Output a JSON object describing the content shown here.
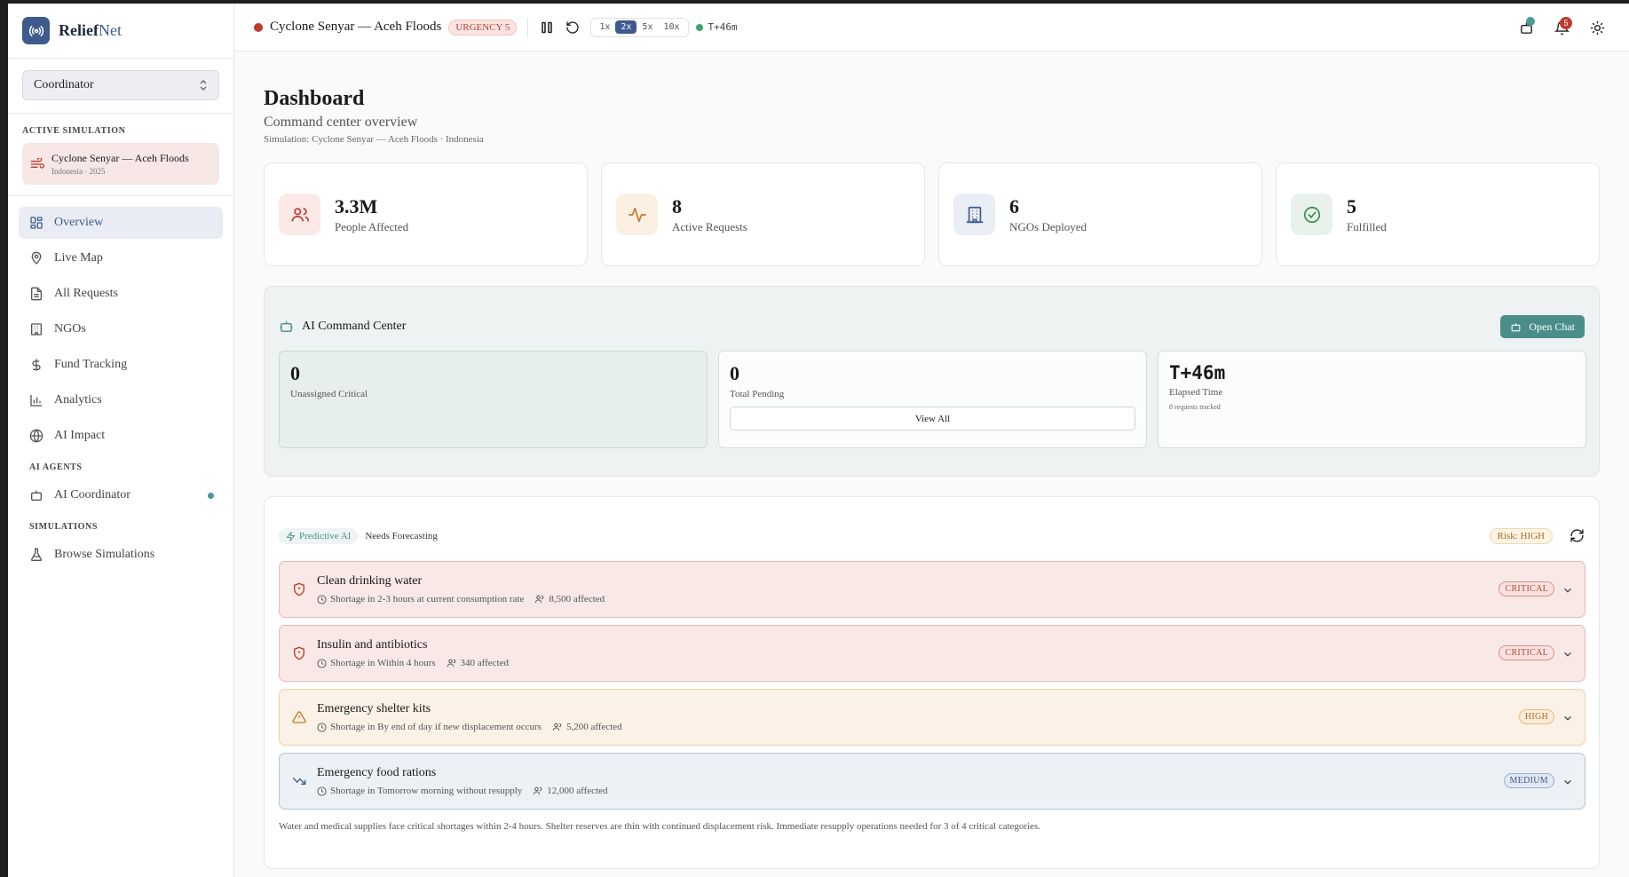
{
  "brand": {
    "name_a": "Relief",
    "name_b": "Net"
  },
  "role": {
    "selected": "Coordinator"
  },
  "active_simulation": {
    "label": "ACTIVE SIMULATION",
    "title": "Cyclone Senyar — Aceh Floods",
    "subtitle": "Indonesia · 2025"
  },
  "nav": {
    "items": [
      {
        "label": "Overview",
        "icon": "grid-icon"
      },
      {
        "label": "Live Map",
        "icon": "map-pin-icon"
      },
      {
        "label": "All Requests",
        "icon": "document-icon"
      },
      {
        "label": "NGOs",
        "icon": "building-icon"
      },
      {
        "label": "Fund Tracking",
        "icon": "dollar-icon"
      },
      {
        "label": "Analytics",
        "icon": "bar-chart-icon"
      },
      {
        "label": "AI Impact",
        "icon": "globe-icon"
      }
    ],
    "agents_label": "AI AGENTS",
    "agent_item": "AI Coordinator",
    "simulations_label": "SIMULATIONS",
    "simulations_item": "Browse Simulations"
  },
  "topbar": {
    "sim_title": "Cyclone Senyar — Aceh Floods",
    "urgency": "URGENCY 5",
    "speeds": [
      "1x",
      "2x",
      "5x",
      "10x"
    ],
    "active_speed": "2x",
    "elapsed": "T+46m",
    "notifications": "5"
  },
  "header": {
    "title": "Dashboard",
    "subtitle": "Command center overview",
    "meta": "Simulation: Cyclone Senyar — Aceh Floods · Indonesia"
  },
  "stats": [
    {
      "value": "3.3M",
      "label": "People Affected",
      "icon": "people-icon",
      "bg": "#fbe9e7",
      "color": "#c0392b"
    },
    {
      "value": "8",
      "label": "Active Requests",
      "icon": "activity-icon",
      "bg": "#fcf0e3",
      "color": "#c07a22"
    },
    {
      "value": "6",
      "label": "NGOs Deployed",
      "icon": "building-icon",
      "bg": "#e9edf4",
      "color": "#3f5a8c"
    },
    {
      "value": "5",
      "label": "Fulfilled",
      "icon": "check-circle-icon",
      "bg": "#e8f2ea",
      "color": "#3a8a50"
    }
  ],
  "ai_center": {
    "title": "AI Command Center",
    "open_chat": "Open Chat",
    "unassigned_value": "0",
    "unassigned_label": "Unassigned Critical",
    "pending_value": "0",
    "pending_label": "Total Pending",
    "view_all": "View All",
    "elapsed_value": "T+46m",
    "elapsed_label": "Elapsed Time",
    "elapsed_note": "8 requests tracked"
  },
  "forecast": {
    "chip": "Predictive AI",
    "title": "Needs Forecasting",
    "risk": "Risk: HIGH",
    "rows": [
      {
        "name": "Clean drinking water",
        "shortage": "Shortage in 2-3 hours at current consumption rate",
        "affected": "8,500 affected",
        "level": "CRITICAL",
        "kind": "critical"
      },
      {
        "name": "Insulin and antibiotics",
        "shortage": "Shortage in Within 4 hours",
        "affected": "340 affected",
        "level": "CRITICAL",
        "kind": "critical"
      },
      {
        "name": "Emergency shelter kits",
        "shortage": "Shortage in By end of day if new displacement occurs",
        "affected": "5,200 affected",
        "level": "HIGH",
        "kind": "high"
      },
      {
        "name": "Emergency food rations",
        "shortage": "Shortage in Tomorrow morning without resupply",
        "affected": "12,000 affected",
        "level": "MEDIUM",
        "kind": "medium"
      }
    ],
    "summary": "Water and medical supplies face critical shortages within 2-4 hours. Shelter reserves are thin with continued displacement risk. Immediate resupply operations needed for 3 of 4 critical categories."
  }
}
